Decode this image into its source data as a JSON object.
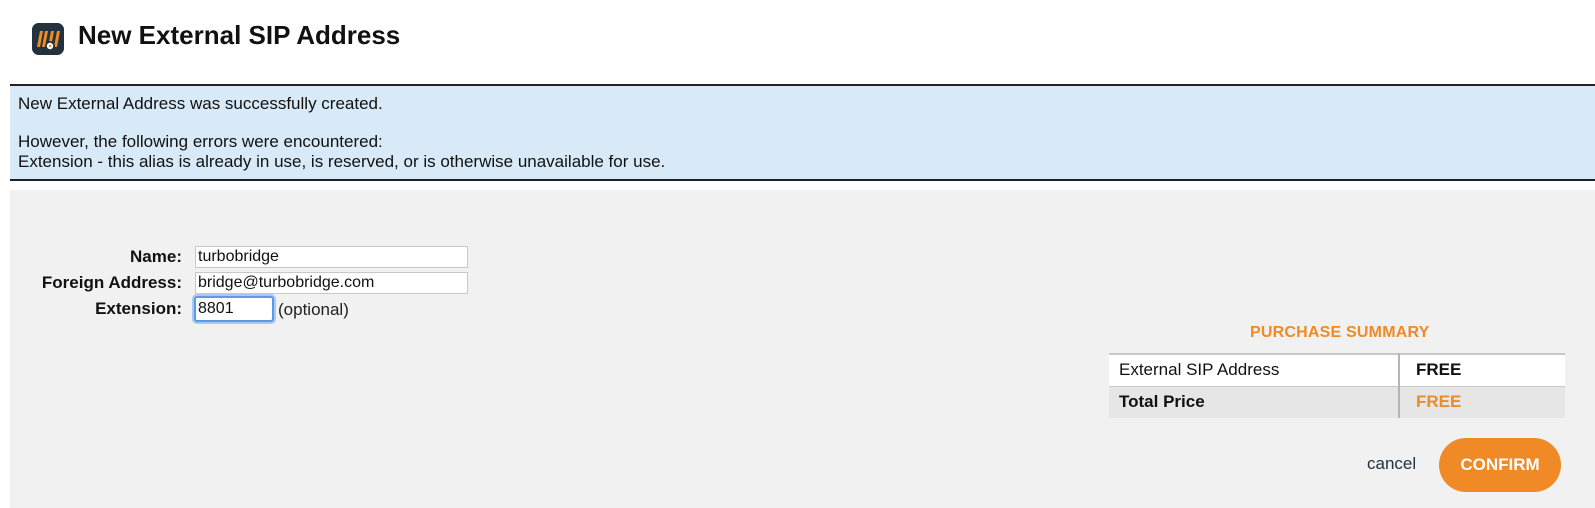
{
  "header": {
    "title": "New External SIP Address",
    "logo_icon": "turbobridge-logo-icon"
  },
  "notice": {
    "success": "New External Address was successfully created.",
    "errors_intro": "However, the following errors were encountered:",
    "error_1": "Extension - this alias is already in use, is reserved, or is otherwise unavailable for use."
  },
  "form": {
    "name_label": "Name:",
    "name_value": "turbobridge",
    "foreign_label": "Foreign Address:",
    "foreign_value": "bridge@turbobridge.com",
    "extension_label": "Extension:",
    "extension_value": "8801",
    "extension_note": "(optional)"
  },
  "summary": {
    "title": "PURCHASE SUMMARY",
    "item_name": "External SIP Address",
    "item_price": "FREE",
    "total_label": "Total Price",
    "total_price": "FREE"
  },
  "actions": {
    "cancel_label": "cancel",
    "confirm_label": "CONFIRM"
  },
  "colors": {
    "accent": "#ef8a27",
    "notice_bg": "#d8eaf7",
    "form_bg": "#f1f1f1",
    "logo_bg": "#22323f"
  }
}
